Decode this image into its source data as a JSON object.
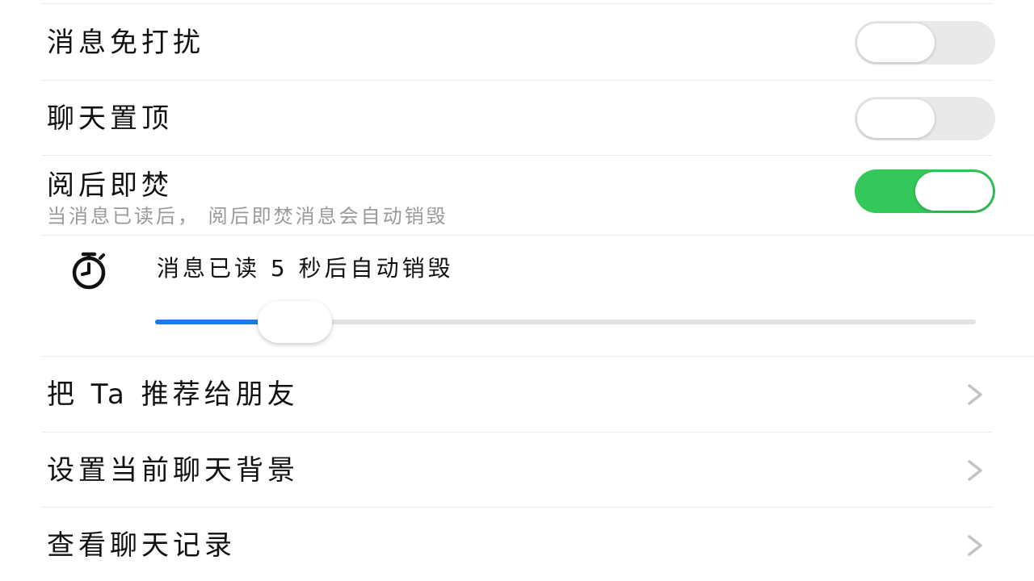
{
  "settings": {
    "mute": {
      "label": "消息免打扰",
      "on": false
    },
    "pin": {
      "label": "聊天置顶",
      "on": false
    },
    "burn": {
      "label": "阅后即焚",
      "description": "当消息已读后， 阅后即焚消息会自动销毁",
      "on": true
    }
  },
  "burn_timer": {
    "icon": "stopwatch-icon",
    "text": "消息已读 5 秒后自动销毁",
    "slider_fraction": 0.17,
    "fill_color": "#1a7cf0"
  },
  "links": [
    {
      "label": "把 Ta 推荐给朋友",
      "icon": "chevron-right-icon"
    },
    {
      "label": "设置当前聊天背景",
      "icon": "chevron-right-icon"
    },
    {
      "label": "查看聊天记录",
      "icon": "chevron-right-icon"
    }
  ],
  "colors": {
    "toggle_on": "#34c759",
    "toggle_off": "#e9e9ea",
    "slider_fill": "#1a7cf0",
    "chevron": "#c4c4c6"
  }
}
